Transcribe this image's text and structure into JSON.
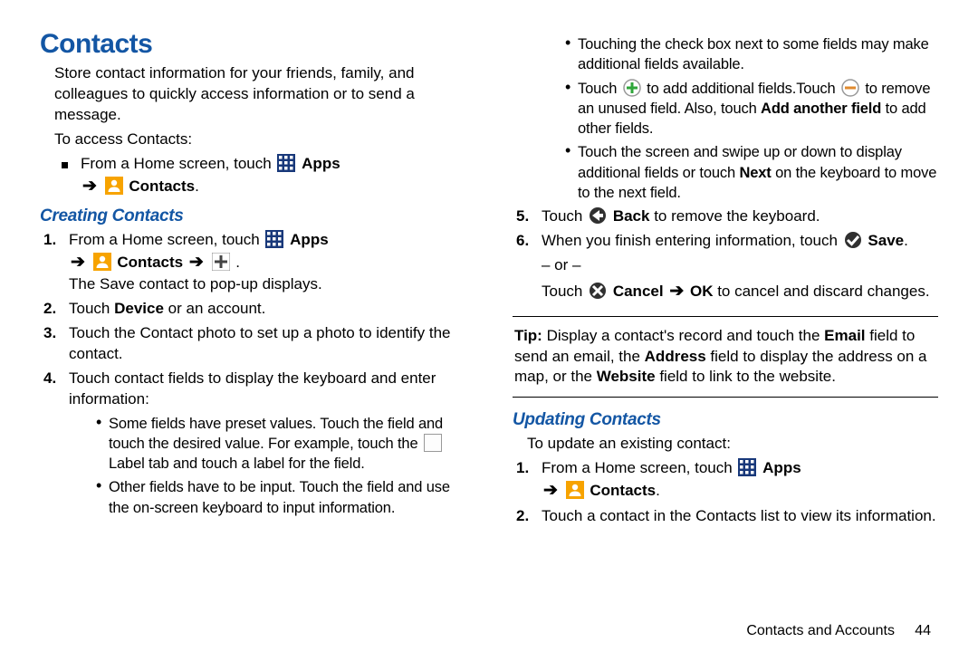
{
  "title": "Contacts",
  "intro": "Store contact information for your friends, family, and colleagues to quickly access information or to send a message.",
  "access_label": "To access Contacts:",
  "access_line1a": "From a Home screen, touch ",
  "apps_label": "Apps",
  "contacts_label": "Contacts",
  "period": ".",
  "creating_heading": "Creating Contacts",
  "c1_pre": "From a Home screen, touch ",
  "c1_popup": "The Save contact to pop-up displays.",
  "c2_a": "Touch ",
  "c2_b": "Device",
  "c2_c": " or an account.",
  "c3": "Touch the Contact photo to set up a photo to identify the contact.",
  "c4": "Touch contact fields to display the keyboard and enter information:",
  "c4_sub1": "Some fields have preset values. Touch the field and touch the desired value. For example, touch the ",
  "c4_sub1_label": " Label tab and touch a label for the field.",
  "c4_sub2": "Other fields have to be input. Touch the field and use the on-screen keyboard to input information.",
  "r_sub1": "Touching the check box next to some fields may make additional fields available.",
  "r_sub2_a": "Touch ",
  "r_sub2_b": " to add additional fields.Touch ",
  "r_sub2_c": " to remove an unused field. Also, touch ",
  "r_sub2_d": "Add another field",
  "r_sub2_e": " to add other fields.",
  "r_sub3_a": "Touch the screen and swipe up or down to display additional fields or touch ",
  "r_sub3_b": "Next",
  "r_sub3_c": " on the keyboard to move to the next field.",
  "r5_a": "Touch ",
  "r5_b": "Back",
  "r5_c": " to remove the keyboard.",
  "r6_a": "When you finish entering information, touch ",
  "r6_b": "Save",
  "r6_or": "– or –",
  "r6_c1": "Touch ",
  "r6_c2": "Cancel",
  "r6_c3": "OK",
  "r6_c4": " to cancel and discard changes.",
  "tip_label": "Tip:",
  "tip_a": " Display a contact's record and touch the ",
  "tip_b": "Email",
  "tip_c": " field to send an email, the ",
  "tip_d": "Address",
  "tip_e": " field to display the address on a map, or the ",
  "tip_f": "Website",
  "tip_g": " field to link to the website.",
  "updating_heading": "Updating Contacts",
  "u_intro": "To update an existing contact:",
  "u1": "From a Home screen, touch ",
  "u2": "Touch a contact in the Contacts list to view its information.",
  "footer_text": "Contacts and Accounts",
  "footer_page": "44"
}
